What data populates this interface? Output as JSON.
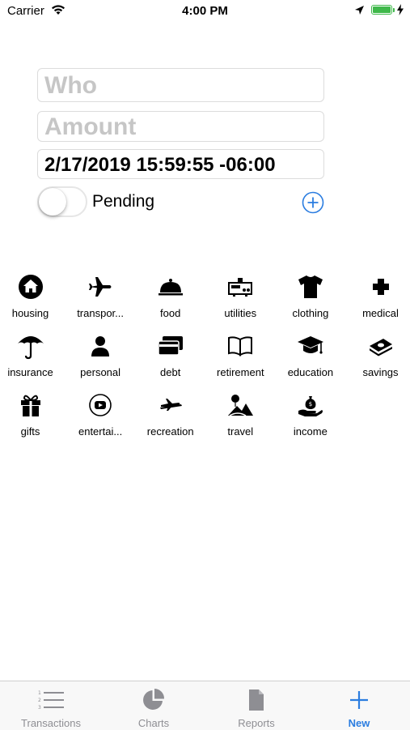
{
  "status_bar": {
    "carrier": "Carrier",
    "time": "4:00 PM",
    "battery_color": "#3fb84a"
  },
  "form": {
    "who_placeholder": "Who",
    "amount_placeholder": "Amount",
    "date_value": "2/17/2019 15:59:55 -06:00",
    "pending_label": "Pending",
    "pending_on": false,
    "accent_color": "#2b7de0"
  },
  "categories": [
    {
      "label": "housing",
      "icon": "house-icon"
    },
    {
      "label": "transpor...",
      "icon": "airplane-icon"
    },
    {
      "label": "food",
      "icon": "cloche-icon"
    },
    {
      "label": "utilities",
      "icon": "meter-icon"
    },
    {
      "label": "clothing",
      "icon": "shirt-icon"
    },
    {
      "label": "medical",
      "icon": "medical-cross-icon"
    },
    {
      "label": "insurance",
      "icon": "umbrella-icon"
    },
    {
      "label": "personal",
      "icon": "person-icon"
    },
    {
      "label": "debt",
      "icon": "credit-cards-icon"
    },
    {
      "label": "retirement",
      "icon": "book-icon"
    },
    {
      "label": "education",
      "icon": "graduation-cap-icon"
    },
    {
      "label": "savings",
      "icon": "money-stack-icon"
    },
    {
      "label": "gifts",
      "icon": "gift-icon"
    },
    {
      "label": "entertai...",
      "icon": "play-button-icon"
    },
    {
      "label": "recreation",
      "icon": "plane-ticket-icon"
    },
    {
      "label": "travel",
      "icon": "landscape-icon"
    },
    {
      "label": "income",
      "icon": "money-bag-hand-icon"
    }
  ],
  "tab_bar": {
    "tabs": [
      {
        "label": "Transactions",
        "icon": "list-icon",
        "active": false
      },
      {
        "label": "Charts",
        "icon": "pie-chart-icon",
        "active": false
      },
      {
        "label": "Reports",
        "icon": "document-icon",
        "active": false
      },
      {
        "label": "New",
        "icon": "plus-icon",
        "active": true
      }
    ]
  }
}
